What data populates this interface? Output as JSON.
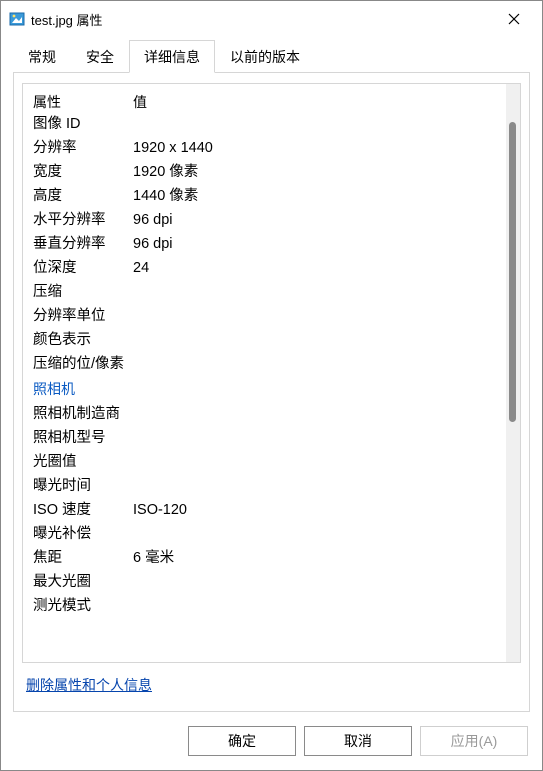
{
  "window": {
    "title": "test.jpg 属性"
  },
  "tabs": {
    "general": "常规",
    "security": "安全",
    "details": "详细信息",
    "previous": "以前的版本"
  },
  "headers": {
    "property": "属性",
    "value": "值"
  },
  "sections": {
    "image_id": "图像 ID",
    "camera": "照相机"
  },
  "props": {
    "resolution": {
      "label": "分辨率",
      "value": "1920 x 1440"
    },
    "width": {
      "label": "宽度",
      "value": "1920 像素"
    },
    "height": {
      "label": "高度",
      "value": "1440 像素"
    },
    "hres": {
      "label": "水平分辨率",
      "value": "96 dpi"
    },
    "vres": {
      "label": "垂直分辨率",
      "value": "96 dpi"
    },
    "bitdepth": {
      "label": "位深度",
      "value": "24"
    },
    "compression": {
      "label": "压缩",
      "value": ""
    },
    "resunit": {
      "label": "分辨率单位",
      "value": ""
    },
    "colorrep": {
      "label": "颜色表示",
      "value": ""
    },
    "compbits": {
      "label": "压缩的位/像素",
      "value": ""
    },
    "maker": {
      "label": "照相机制造商",
      "value": ""
    },
    "model": {
      "label": "照相机型号",
      "value": ""
    },
    "fnumber": {
      "label": "光圈值",
      "value": ""
    },
    "exposure": {
      "label": "曝光时间",
      "value": ""
    },
    "iso": {
      "label": "ISO 速度",
      "value": "ISO-120"
    },
    "expbias": {
      "label": "曝光补偿",
      "value": ""
    },
    "focal": {
      "label": "焦距",
      "value": "6 毫米"
    },
    "maxap": {
      "label": "最大光圈",
      "value": ""
    },
    "metering": {
      "label": "测光模式",
      "value": ""
    }
  },
  "link": "删除属性和个人信息",
  "buttons": {
    "ok": "确定",
    "cancel": "取消",
    "apply": "应用(A)"
  }
}
